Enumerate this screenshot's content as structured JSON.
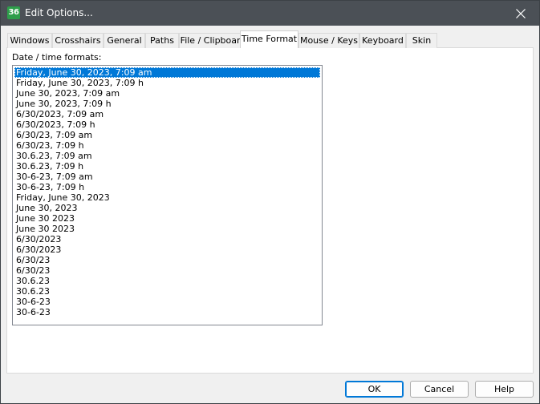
{
  "window": {
    "title": "Edit Options...",
    "app_icon_text": "36"
  },
  "tabs": [
    {
      "label": "Windows",
      "active": false
    },
    {
      "label": "Crosshairs",
      "active": false
    },
    {
      "label": "General",
      "active": false
    },
    {
      "label": "Paths",
      "active": false
    },
    {
      "label": "File / Clipboard",
      "active": false
    },
    {
      "label": "Time Format",
      "active": true
    },
    {
      "label": "Mouse / Keys",
      "active": false
    },
    {
      "label": "Keyboard",
      "active": false
    },
    {
      "label": "Skin",
      "active": false
    }
  ],
  "time_format": {
    "list_label": "Date / time formats:",
    "selected_index": 0,
    "items": [
      "Friday, June 30, 2023, 7:09 am",
      "Friday, June 30, 2023, 7:09 h",
      "June 30, 2023, 7:09 am",
      "June 30, 2023, 7:09 h",
      "6/30/2023, 7:09 am",
      "6/30/2023, 7:09 h",
      "6/30/23, 7:09 am",
      "6/30/23, 7:09 h",
      "30.6.23, 7:09 am",
      "30.6.23, 7:09 h",
      "30-6-23, 7:09 am",
      "30-6-23, 7:09 h",
      "Friday, June 30, 2023",
      "June 30, 2023",
      "June 30 2023",
      "June 30 2023",
      "6/30/2023",
      "6/30/2023",
      "6/30/23",
      "6/30/23",
      "30.6.23",
      "30.6.23",
      "30-6-23",
      "30-6-23"
    ]
  },
  "buttons": {
    "ok": "OK",
    "cancel": "Cancel",
    "help": "Help"
  },
  "colors": {
    "titlebar": "#4b5056",
    "selection": "#0078d7",
    "app_icon": "#2e9e4a"
  },
  "icons": {
    "app": "app-icon",
    "close": "close-icon"
  }
}
